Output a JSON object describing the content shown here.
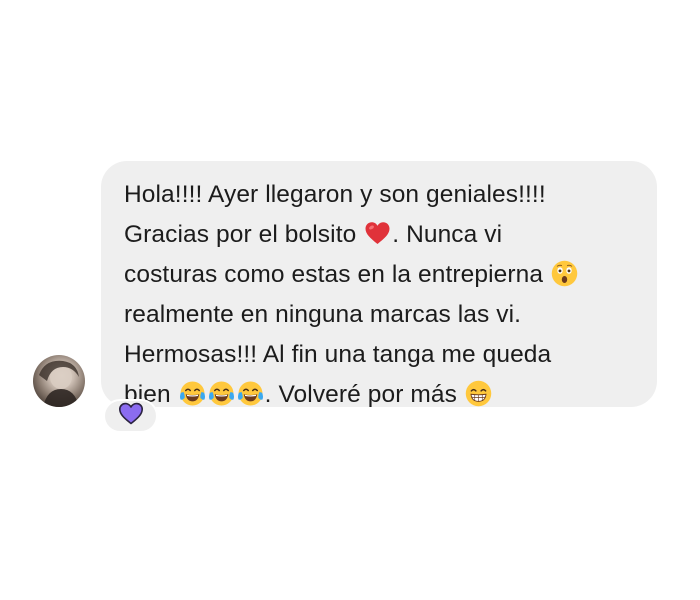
{
  "message": {
    "segments": [
      {
        "type": "text",
        "value": "Hola!!!! Ayer llegaron y son geniales!!!!\nGracias por el bolsito "
      },
      {
        "type": "emoji",
        "icon": "red-heart-emoji"
      },
      {
        "type": "text",
        "value": ". Nunca vi\ncosturas como estas en la entrepierna "
      },
      {
        "type": "emoji",
        "icon": "astonished-face-emoji"
      },
      {
        "type": "text",
        "value": "\nrealmente en ninguna marcas las vi.\nHermosas!!! Al fin una tanga me queda\nbien "
      },
      {
        "type": "emoji",
        "icon": "tears-of-joy-emoji"
      },
      {
        "type": "emoji",
        "icon": "tears-of-joy-emoji"
      },
      {
        "type": "emoji",
        "icon": "tears-of-joy-emoji"
      },
      {
        "type": "text",
        "value": ". Volveré por más "
      },
      {
        "type": "emoji",
        "icon": "beaming-grin-emoji"
      }
    ]
  },
  "reaction": {
    "icon": "purple-heart-icon",
    "color": "#7b5fe6"
  },
  "colors": {
    "bubble_background": "#efefef",
    "text": "#1c1c1c",
    "page_background": "#ffffff"
  }
}
